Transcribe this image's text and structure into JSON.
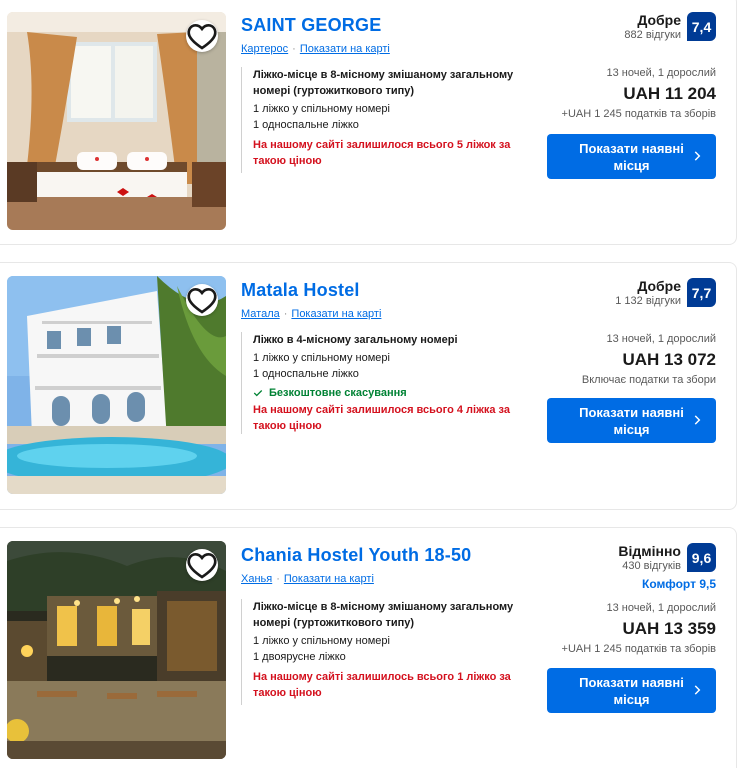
{
  "listings": [
    {
      "name": "SAINT GEORGE",
      "location": "Картерос",
      "map_link": "Показати на карті",
      "room_type": "Ліжко-місце в 8-місному змішаному загальному номері (гуртожиткового типу)",
      "room_lines": [
        "1 ліжко у спільному номері",
        "1 односпальне ліжко"
      ],
      "free_cancellation": "",
      "urgency": "На нашому сайті залишилося всього 5 ліжок за такою ціною",
      "review_word": "Добре",
      "review_count": "882 відгуки",
      "score": "7,4",
      "comfort": "",
      "nights": "13 ночей, 1 дорослий",
      "price": "UAH 11 204",
      "taxes": "+UAH 1 245 податків та зборів",
      "cta": "Показати наявні місця"
    },
    {
      "name": "Matala Hostel",
      "location": "Матала",
      "map_link": "Показати на карті",
      "room_type": "Ліжко в 4-місному загальному номері",
      "room_lines": [
        "1 ліжко у спільному номері",
        "1 односпальне ліжко"
      ],
      "free_cancellation": "Безкоштовне скасування",
      "urgency": "На нашому сайті залишилося всього 4 ліжка за такою ціною",
      "review_word": "Добре",
      "review_count": "1 132 відгуки",
      "score": "7,7",
      "comfort": "",
      "nights": "13 ночей, 1 дорослий",
      "price": "UAH 13 072",
      "taxes": "Включає податки та збори",
      "cta": "Показати наявні місця"
    },
    {
      "name": "Chania Hostel Youth 18-50",
      "location": "Ханья",
      "map_link": "Показати на карті",
      "room_type": "Ліжко-місце в 8-місному змішаному загальному номері (гуртожиткового типу)",
      "room_lines": [
        "1 ліжко у спільному номері",
        "1 двоярусне ліжко"
      ],
      "free_cancellation": "",
      "urgency": "На нашому сайті залишилось всього 1 ліжко за такою ціною",
      "review_word": "Відмінно",
      "review_count": "430 відгуків",
      "score": "9,6",
      "comfort": "Комфорт 9,5",
      "nights": "13 ночей, 1 дорослий",
      "price": "UAH 13 359",
      "taxes": "+UAH 1 245 податків та зборів",
      "cta": "Показати наявні місця"
    }
  ],
  "icons": {
    "favorite": "heart-outline-icon",
    "chevron": "chevron-right-icon",
    "check": "checkmark-icon"
  },
  "colors": {
    "link": "#006ce4",
    "score_bg": "#003b95",
    "urgency": "#d4111e",
    "free_cancel": "#008234",
    "button": "#006ce4"
  }
}
